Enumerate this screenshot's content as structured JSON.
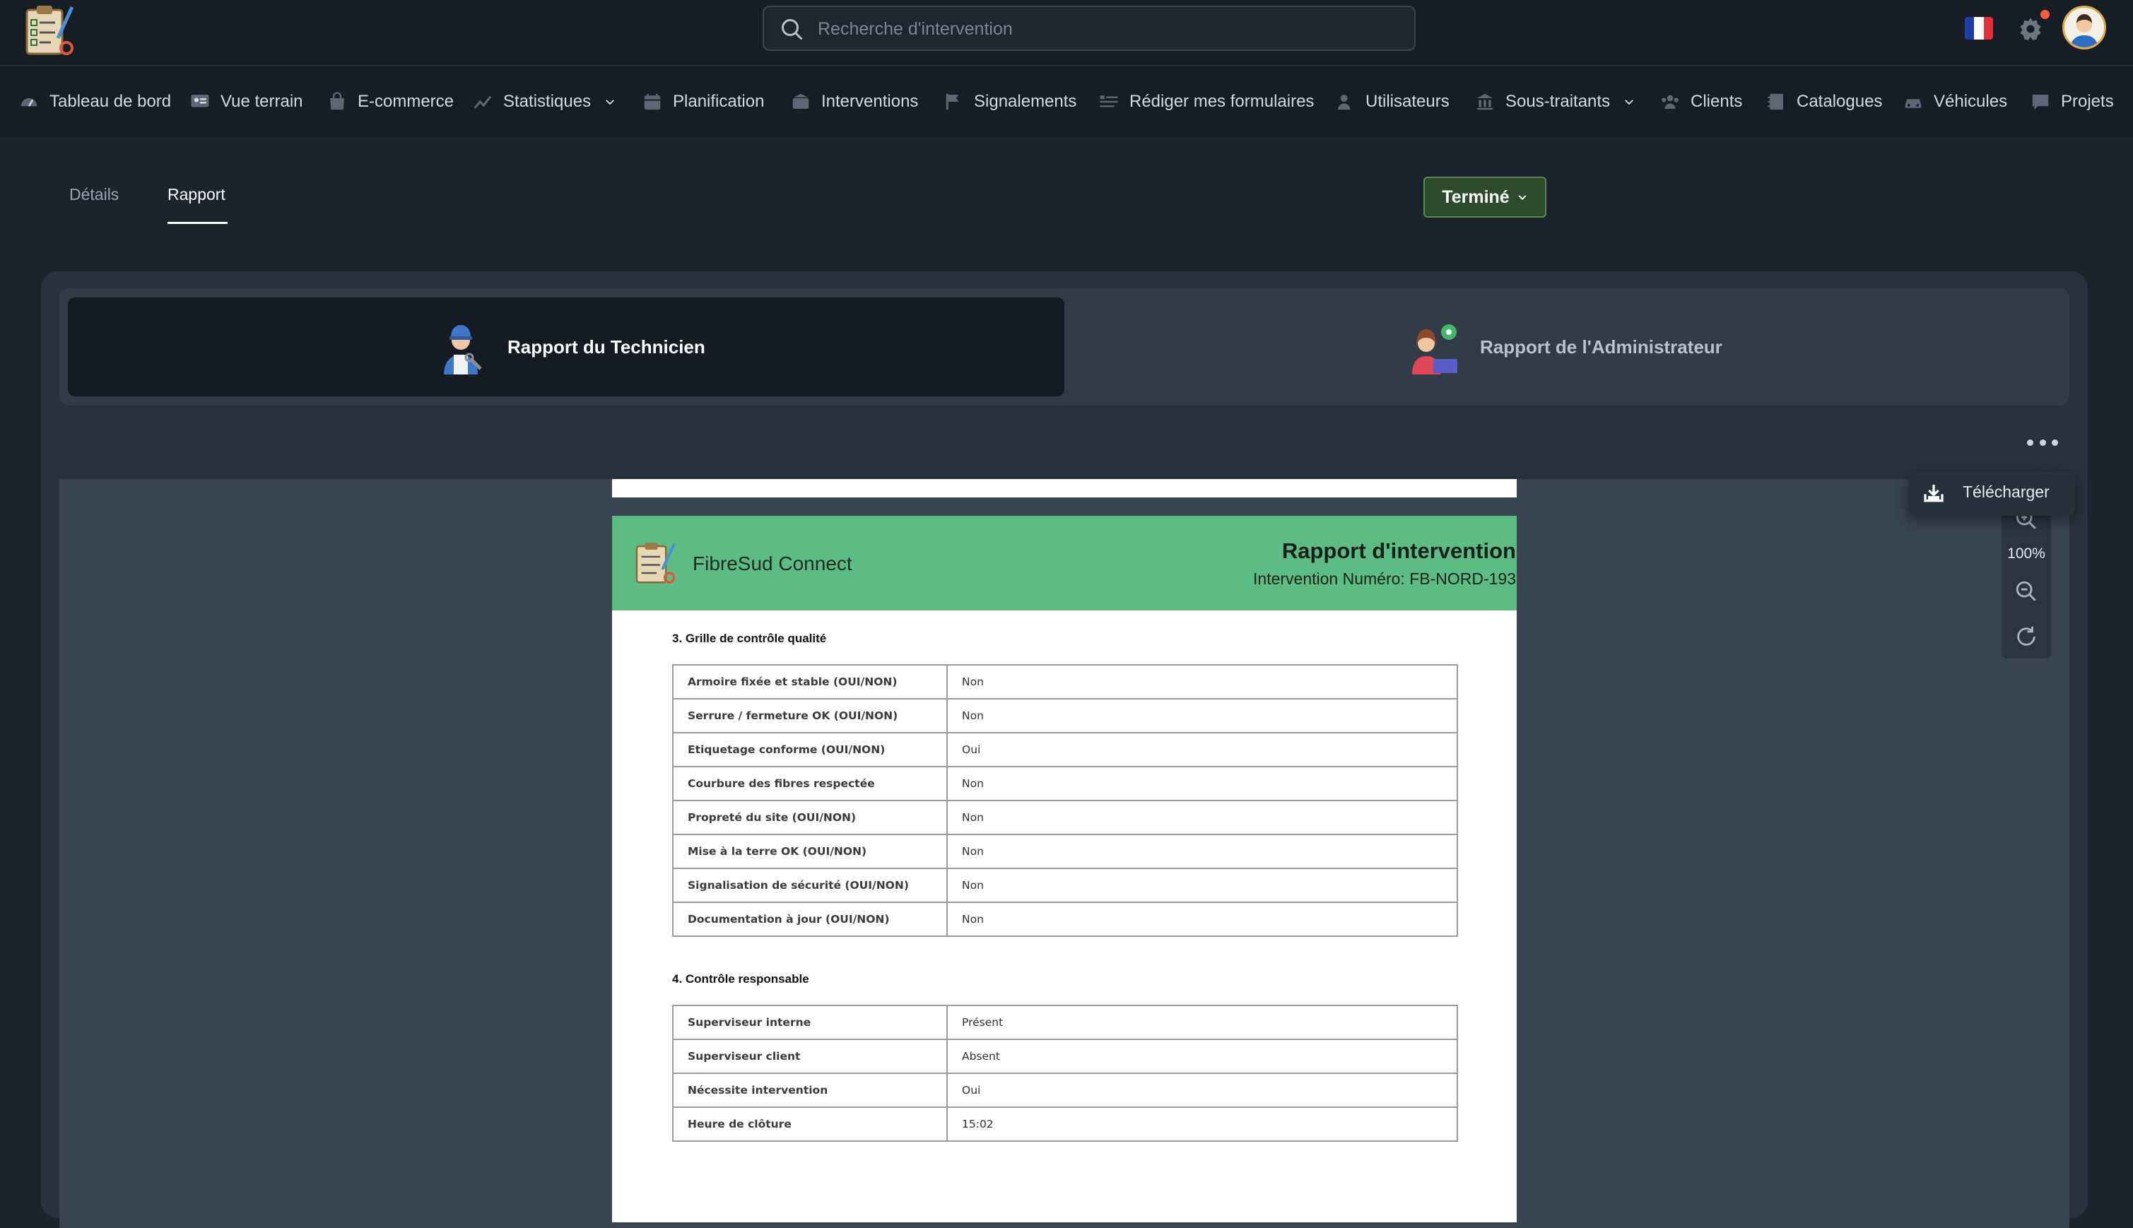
{
  "search": {
    "placeholder": "Recherche d'intervention"
  },
  "nav": {
    "items": [
      {
        "label": "Tableau de bord",
        "icon": "dashboard-gauge-icon"
      },
      {
        "label": "Vue terrain",
        "icon": "map-view-icon"
      },
      {
        "label": "E-commerce",
        "icon": "shopping-bag-icon"
      },
      {
        "label": "Statistiques",
        "icon": "chart-icon",
        "dropdown": true
      },
      {
        "label": "Planification",
        "icon": "calendar-icon"
      },
      {
        "label": "Interventions",
        "icon": "toolbox-icon"
      },
      {
        "label": "Signalements",
        "icon": "flag-icon"
      },
      {
        "label": "Rédiger mes formulaires",
        "icon": "form-icon"
      },
      {
        "label": "Utilisateurs",
        "icon": "user-icon"
      },
      {
        "label": "Sous-traitants",
        "icon": "building-icon",
        "dropdown": true
      },
      {
        "label": "Clients",
        "icon": "clients-icon"
      },
      {
        "label": "Catalogues",
        "icon": "catalog-icon"
      },
      {
        "label": "Véhicules",
        "icon": "car-icon"
      },
      {
        "label": "Projets",
        "icon": "projects-icon"
      }
    ]
  },
  "tabs": {
    "details": "Détails",
    "rapport": "Rapport",
    "active": "rapport"
  },
  "status": {
    "label": "Terminé",
    "color": "#2d4a2c"
  },
  "report_switch": {
    "technician": "Rapport du Technicien",
    "admin": "Rapport de l'Administrateur",
    "active": "technician"
  },
  "menu": {
    "download": "Télécharger"
  },
  "zoom": {
    "level": "100%"
  },
  "document": {
    "company": "FibreSud Connect",
    "title": "Rapport d'intervention",
    "number": "Intervention Numéro: FB-NORD-193",
    "header_color": "#5cbc84",
    "section3": {
      "title": "3. Grille de contrôle qualité",
      "rows": [
        {
          "k": "Armoire fixée et stable (OUI/NON)",
          "v": "Non"
        },
        {
          "k": "Serrure / fermeture OK (OUI/NON)",
          "v": "Non"
        },
        {
          "k": "Etiquetage conforme (OUI/NON)",
          "v": "Oui"
        },
        {
          "k": "Courbure des fibres respectée",
          "v": "Non"
        },
        {
          "k": "Propreté du site (OUI/NON)",
          "v": "Non"
        },
        {
          "k": "Mise à la terre OK (OUI/NON)",
          "v": "Non"
        },
        {
          "k": "Signalisation de sécurité (OUI/NON)",
          "v": "Non"
        },
        {
          "k": "Documentation à jour (OUI/NON)",
          "v": "Non"
        }
      ]
    },
    "section4": {
      "title": "4. Contrôle responsable",
      "rows": [
        {
          "k": "Superviseur interne",
          "v": "Présent"
        },
        {
          "k": "Superviseur client",
          "v": "Absent"
        },
        {
          "k": "Nécessite intervention",
          "v": "Oui"
        },
        {
          "k": "Heure de clôture",
          "v": "15:02"
        }
      ]
    }
  }
}
